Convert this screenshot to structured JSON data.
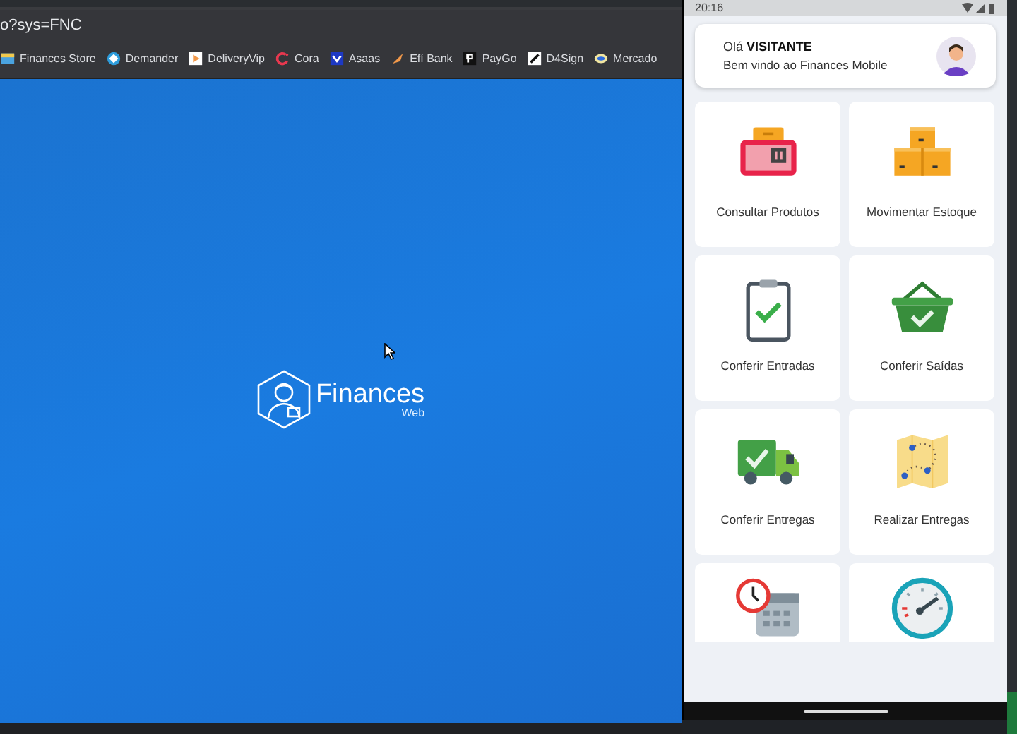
{
  "browser": {
    "address": "o?sys=FNC",
    "bookmarks": [
      {
        "label": "Finances Store"
      },
      {
        "label": "Demander"
      },
      {
        "label": "DeliveryVip"
      },
      {
        "label": "Cora"
      },
      {
        "label": "Asaas"
      },
      {
        "label": "Efí Bank"
      },
      {
        "label": "PayGo"
      },
      {
        "label": "D4Sign"
      },
      {
        "label": "Mercado"
      }
    ],
    "logo": {
      "name": "Finances",
      "subtitle": "Web"
    }
  },
  "phone": {
    "status_bar": {
      "time": "20:16"
    },
    "greeting": {
      "prefix": "Olá",
      "user": "VISITANTE",
      "subtitle": "Bem vindo ao Finances Mobile"
    },
    "tiles": [
      {
        "label": "Consultar Produtos"
      },
      {
        "label": "Movimentar Estoque"
      },
      {
        "label": "Conferir Entradas"
      },
      {
        "label": "Conferir Saídas"
      },
      {
        "label": "Conferir Entregas"
      },
      {
        "label": "Realizar Entregas"
      },
      {
        "clipped": true
      },
      {
        "clipped": true
      }
    ]
  }
}
